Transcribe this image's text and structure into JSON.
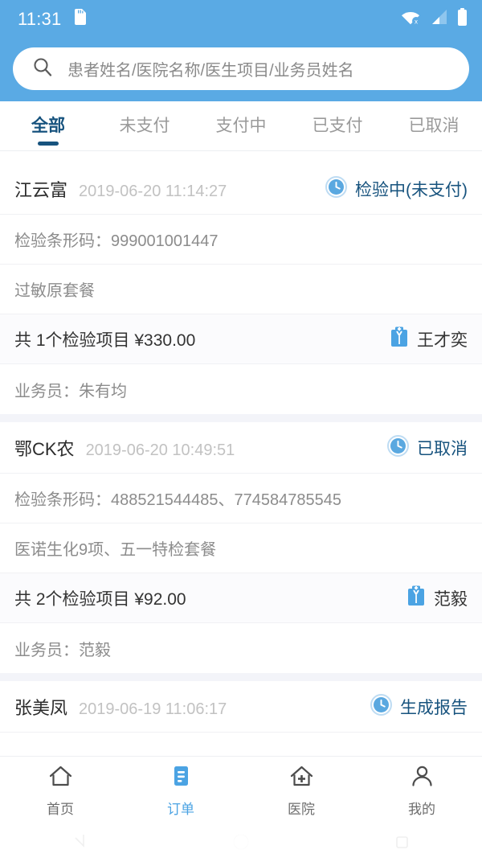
{
  "statusbar": {
    "time": "11:31",
    "icons": [
      "sd-card-icon",
      "wifi-no-internet-icon",
      "cellular-signal-icon",
      "battery-full-icon"
    ]
  },
  "search": {
    "placeholder": "患者姓名/医院名称/医生项目/业务员姓名",
    "icon": "search-icon"
  },
  "tabs": [
    {
      "label": "全部",
      "active": true
    },
    {
      "label": "未支付",
      "active": false
    },
    {
      "label": "支付中",
      "active": false
    },
    {
      "label": "已支付",
      "active": false
    },
    {
      "label": "已取消",
      "active": false
    }
  ],
  "orders": [
    {
      "patient": "江云富",
      "time": "2019-06-20 11:14:27",
      "status": "检验中(未支付)",
      "status_icon": "clock-icon",
      "barcode_label": "检验条形码：",
      "barcode_value": "999001001447",
      "packages": "过敏原套餐",
      "summary": "共 1个检验项目 ¥330.00",
      "doctor": "王才奕",
      "doctor_icon": "doctor-coat-icon",
      "agent": "业务员：朱有均"
    },
    {
      "patient": "鄂CK农",
      "time": "2019-06-20 10:49:51",
      "status": "已取消",
      "status_icon": "clock-icon",
      "barcode_label": "检验条形码：",
      "barcode_value": "488521544485、774584785545",
      "packages": "医诺生化9项、五一特检套餐",
      "summary": "共 2个检验项目 ¥92.00",
      "doctor": "范毅",
      "doctor_icon": "doctor-coat-icon",
      "agent": "业务员：范毅"
    },
    {
      "patient": "张美凤",
      "time": "2019-06-19 11:06:17",
      "status": "生成报告",
      "status_icon": "clock-icon"
    }
  ],
  "bottomnav": [
    {
      "label": "首页",
      "icon": "home-icon",
      "active": false
    },
    {
      "label": "订单",
      "icon": "order-document-icon",
      "active": true
    },
    {
      "label": "医院",
      "icon": "hospital-icon",
      "active": false
    },
    {
      "label": "我的",
      "icon": "person-icon",
      "active": false
    }
  ],
  "androidnav": {
    "back": "back-icon",
    "home": "home-gesture-icon",
    "recents": "recents-icon"
  },
  "colors": {
    "header_blue": "#5aaae4",
    "accent_blue": "#4ba3e3",
    "active_tab": "#17537e",
    "muted_text": "#8c8c8c",
    "card_gap": "#f3f4f9"
  }
}
